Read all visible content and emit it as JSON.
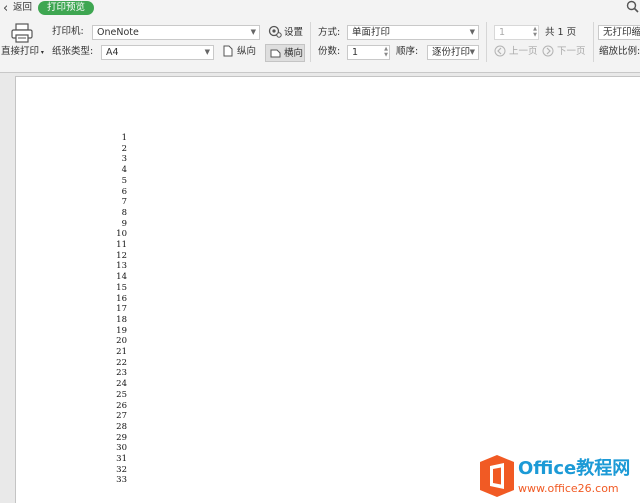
{
  "header": {
    "back_label": "返回",
    "preview_badge": "打印预览"
  },
  "toolbar": {
    "direct_print_label": "直接打印",
    "printer_label": "打印机:",
    "printer_value": "OneNote",
    "settings_label": "设置",
    "paper_type_label": "纸张类型:",
    "paper_type_value": "A4",
    "portrait_label": "纵向",
    "landscape_label": "横向",
    "mode_label": "方式:",
    "mode_value": "单面打印",
    "copies_label": "份数:",
    "copies_value": "1",
    "order_label": "顺序:",
    "order_value": "逐份打印",
    "page_value": "1",
    "total_pages_label": "共 1 页",
    "prev_page_label": "上一页",
    "next_page_label": "下一页",
    "no_scale_value": "无打印缩",
    "scale_label": "缩放比例:"
  },
  "document": {
    "row_numbers": [
      "1",
      "2",
      "3",
      "4",
      "5",
      "6",
      "7",
      "8",
      "9",
      "10",
      "11",
      "12",
      "13",
      "14",
      "15",
      "16",
      "17",
      "18",
      "19",
      "20",
      "21",
      "22",
      "23",
      "24",
      "25",
      "26",
      "27",
      "28",
      "29",
      "30",
      "31",
      "32",
      "33"
    ]
  },
  "watermark": {
    "brand": "Office教程网",
    "url": "www.office26.com"
  },
  "colors": {
    "badge_green": "#3ea651",
    "logo_orange": "#f15a24",
    "brand_blue": "#1c9ad6"
  },
  "icons": [
    "back-arrow-icon",
    "search-icon",
    "printer-icon",
    "settings-icon",
    "portrait-icon",
    "landscape-icon",
    "prev-page-icon",
    "next-page-icon",
    "office-logo-icon"
  ]
}
